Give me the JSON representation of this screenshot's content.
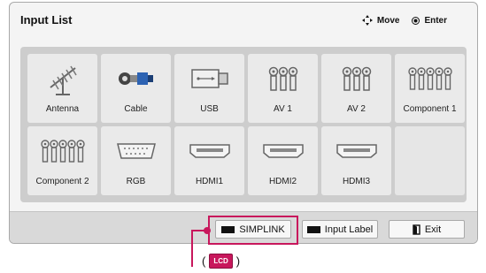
{
  "header": {
    "title": "Input List",
    "move_label": "Move",
    "enter_label": "Enter"
  },
  "inputs": [
    {
      "label": "Antenna",
      "icon": "antenna-icon"
    },
    {
      "label": "Cable",
      "icon": "cable-icon"
    },
    {
      "label": "USB",
      "icon": "usb-icon"
    },
    {
      "label": "AV 1",
      "icon": "av-jacks-icon"
    },
    {
      "label": "AV 2",
      "icon": "av-jacks-icon"
    },
    {
      "label": "Component 1",
      "icon": "component-jacks-icon"
    },
    {
      "label": "Component 2",
      "icon": "component-jacks-icon"
    },
    {
      "label": "RGB",
      "icon": "rgb-port-icon"
    },
    {
      "label": "HDMI1",
      "icon": "hdmi-port-icon"
    },
    {
      "label": "HDMI2",
      "icon": "hdmi-port-icon"
    },
    {
      "label": "HDMI3",
      "icon": "hdmi-port-icon"
    }
  ],
  "footer": {
    "simplink_label": "SIMPLINK",
    "input_label_label": "Input Label",
    "exit_label": "Exit"
  },
  "annotation": {
    "open_paren": "(",
    "badge": "LCD",
    "close_paren": ")"
  },
  "colors": {
    "accent": "#c8175c",
    "panel_bg": "#f4f4f4",
    "grid_bg": "#cdcdcd",
    "tile_bg": "#eaeaea"
  }
}
